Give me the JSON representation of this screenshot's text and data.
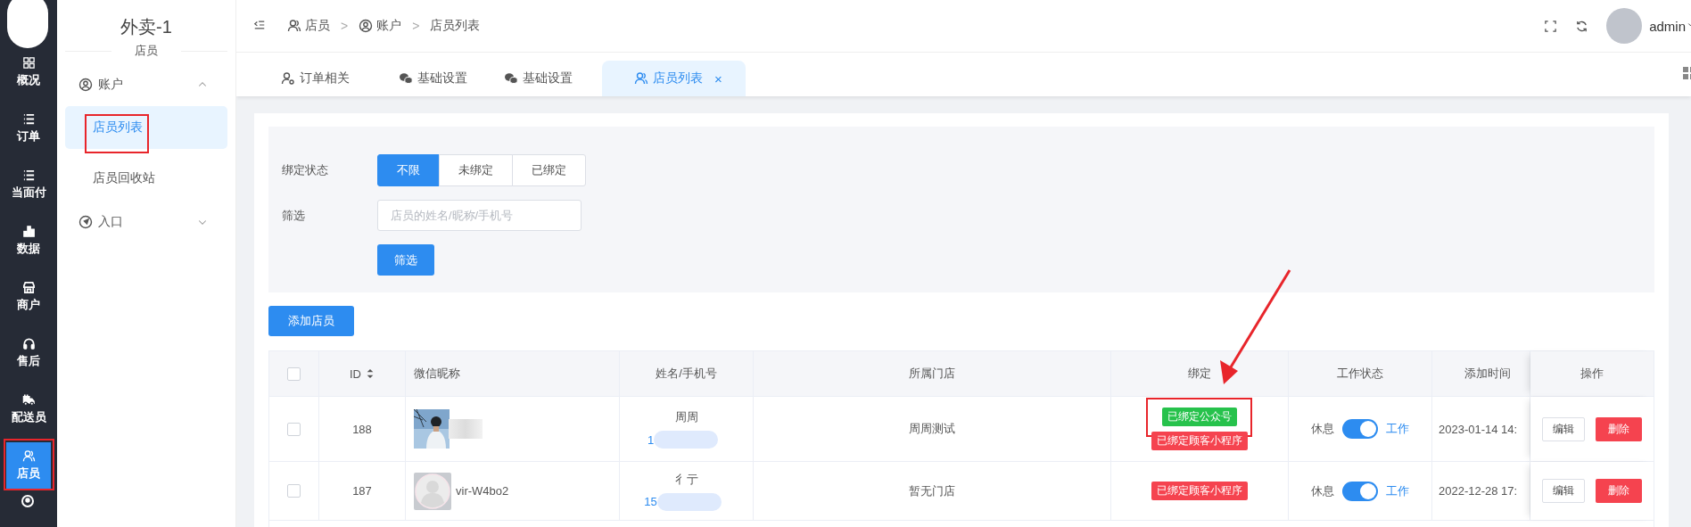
{
  "rail": {
    "items": [
      {
        "label": "概况",
        "selected": false,
        "annotated": false
      },
      {
        "label": "订单",
        "selected": false,
        "annotated": false
      },
      {
        "label": "当面付",
        "selected": false,
        "annotated": false
      },
      {
        "label": "数据",
        "selected": false,
        "annotated": false
      },
      {
        "label": "商户",
        "selected": false,
        "annotated": false
      },
      {
        "label": "售后",
        "selected": false,
        "annotated": false
      },
      {
        "label": "配送员",
        "selected": false,
        "annotated": false
      },
      {
        "label": "店员",
        "selected": true,
        "annotated": true
      }
    ]
  },
  "submenu": {
    "title": "外卖-1",
    "subtitle": "店员",
    "groups": [
      {
        "label": "账户",
        "expanded": true,
        "children": [
          {
            "label": "店员列表",
            "selected": true,
            "annotated": true
          },
          {
            "label": "店员回收站",
            "selected": false,
            "annotated": false
          }
        ]
      },
      {
        "label": "入口",
        "expanded": false
      }
    ]
  },
  "topbar": {
    "breadcrumb": [
      "店员",
      "账户",
      "店员列表"
    ],
    "separators": [
      ">",
      ">"
    ],
    "user": "admin"
  },
  "tabs": [
    {
      "label": "订单相关",
      "selected": false,
      "closable": false
    },
    {
      "label": "基础设置",
      "selected": false,
      "closable": false
    },
    {
      "label": "基础设置",
      "selected": false,
      "closable": false
    },
    {
      "label": "店员列表",
      "selected": true,
      "closable": true,
      "close": "×"
    }
  ],
  "filter": {
    "binding": {
      "label": "绑定状态",
      "options": [
        {
          "label": "不限",
          "selected": true
        },
        {
          "label": "未绑定",
          "selected": false
        },
        {
          "label": "已绑定",
          "selected": false
        }
      ]
    },
    "search": {
      "label": "筛选",
      "placeholder": "店员的姓名/昵称/手机号"
    },
    "submit": "筛选"
  },
  "add_button": "添加店员",
  "table": {
    "columns": [
      "ID",
      "微信昵称",
      "姓名/手机号",
      "所属门店",
      "绑定",
      "工作状态",
      "添加时间",
      "操作"
    ],
    "header_checked": false,
    "rows": [
      {
        "checked": false,
        "id": "188",
        "avatar": {
          "kind": "picture"
        },
        "name": "周周",
        "phone": "1",
        "store": "周周测试",
        "tags": [
          {
            "label": "已绑定公众号",
            "color": "#27c24c",
            "annotated": true
          },
          {
            "label": "已绑定顾客小程序",
            "color": "#f5434f",
            "annotated": false
          }
        ],
        "off_label": "休息",
        "on_label": "工作",
        "on": true,
        "added": "2023-01-14 14:",
        "actions": [
          "编辑",
          "删除"
        ]
      },
      {
        "checked": false,
        "id": "187",
        "nickname": "vir-W4bo2",
        "name": "彳亍",
        "phone": "15",
        "store": "暂无门店",
        "tags": [
          {
            "label": "已绑定顾客小程序",
            "color": "#f5434f",
            "annotated": false
          }
        ],
        "off_label": "休息",
        "on_label": "工作",
        "on": true,
        "added": "2022-12-28 17:",
        "actions": [
          "编辑",
          "删除"
        ]
      }
    ]
  },
  "annotation_arrow": true
}
